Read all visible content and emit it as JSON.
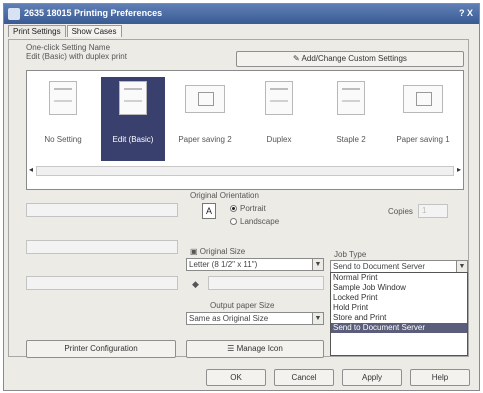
{
  "window": {
    "title": "2635 18015 Printing Preferences",
    "controls": "? X"
  },
  "tabs": [
    {
      "label": "Print Settings",
      "active": true
    },
    {
      "label": "Show Cases",
      "active": false
    }
  ],
  "one_click": {
    "label_line1": "One-click Setting Name",
    "label_line2": "Edit (Basic) with duplex print",
    "add_change_button": "Add/Change Custom Settings"
  },
  "presets": [
    {
      "label": "No Setting",
      "orientation": "portrait"
    },
    {
      "label": "Edit (Basic)",
      "orientation": "portrait",
      "selected": true
    },
    {
      "label": "Paper saving 2",
      "orientation": "landscape"
    },
    {
      "label": "Duplex",
      "orientation": "portrait"
    },
    {
      "label": "Staple 2",
      "orientation": "portrait"
    },
    {
      "label": "Paper saving 1",
      "orientation": "landscape"
    }
  ],
  "scroll": {
    "left": "◂",
    "right": "▸"
  },
  "orientation": {
    "title": "Original Orientation",
    "options": [
      {
        "label": "Portrait",
        "selected": true
      },
      {
        "label": "Landscape",
        "selected": false
      }
    ],
    "icon": "A"
  },
  "original_size": {
    "label": "Original Size",
    "value": "Letter (8 1/2\" x 11\")"
  },
  "output_paper_size": {
    "label": "Output paper Size",
    "value": "Same as Original Size"
  },
  "job_type": {
    "label": "Job Type",
    "value": "Send to Document Server",
    "options": [
      "Normal Print",
      "Sample Job Window",
      "Locked Print",
      "Hold Print",
      "Store and Print",
      "Send to Document Server"
    ],
    "highlighted_index": 5
  },
  "left_fields": [
    {
      "label": "",
      "value": ""
    },
    {
      "label": "",
      "value": ""
    },
    {
      "label": "",
      "value": ""
    }
  ],
  "copies": {
    "label": "Copies",
    "value": "1"
  },
  "printer_config_button": "Printer Configuration",
  "manage_button": "Manage Icon",
  "bottom_buttons": [
    "OK",
    "Cancel",
    "Apply",
    "Help"
  ]
}
